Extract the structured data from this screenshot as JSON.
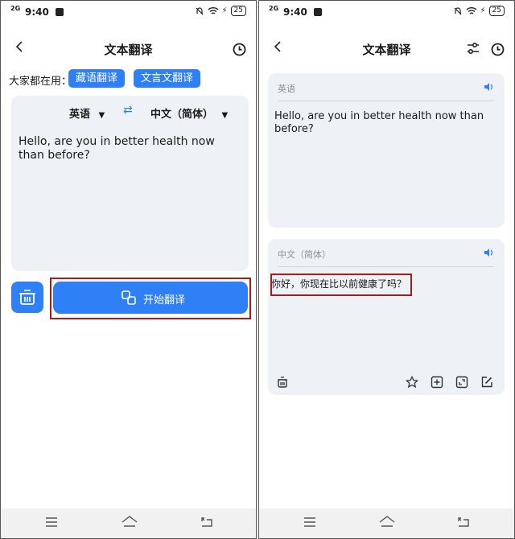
{
  "status": {
    "time": "9:40",
    "network": "2G",
    "battery": "25"
  },
  "left": {
    "title": "文本翻译",
    "common_label": "大家都在用：",
    "chips": [
      "藏语翻译",
      "文言文翻译"
    ],
    "source_lang": "英语",
    "target_lang": "中文（简体）",
    "input_text": "Hello, are you in better health now than before?",
    "start_label": "开始翻译"
  },
  "right": {
    "title": "文本翻译",
    "source_header": "英语",
    "source_text": "Hello, are you in better health now than before?",
    "target_header": "中文（简体）",
    "translation": "你好，你现在比以前健康了吗？"
  },
  "colors": {
    "accent": "#2f7ff5",
    "card_bg": "#eef2f6",
    "highlight": "#a31d1d"
  },
  "icons": [
    "back-arrow-icon",
    "history-clock-icon",
    "swap-icon",
    "trash-basket-icon",
    "translate-icon",
    "speaker-icon",
    "settings-sliders-icon",
    "star-icon",
    "add-icon",
    "expand-icon",
    "edit-icon",
    "menu-icon",
    "home-icon",
    "back-nav-icon"
  ]
}
